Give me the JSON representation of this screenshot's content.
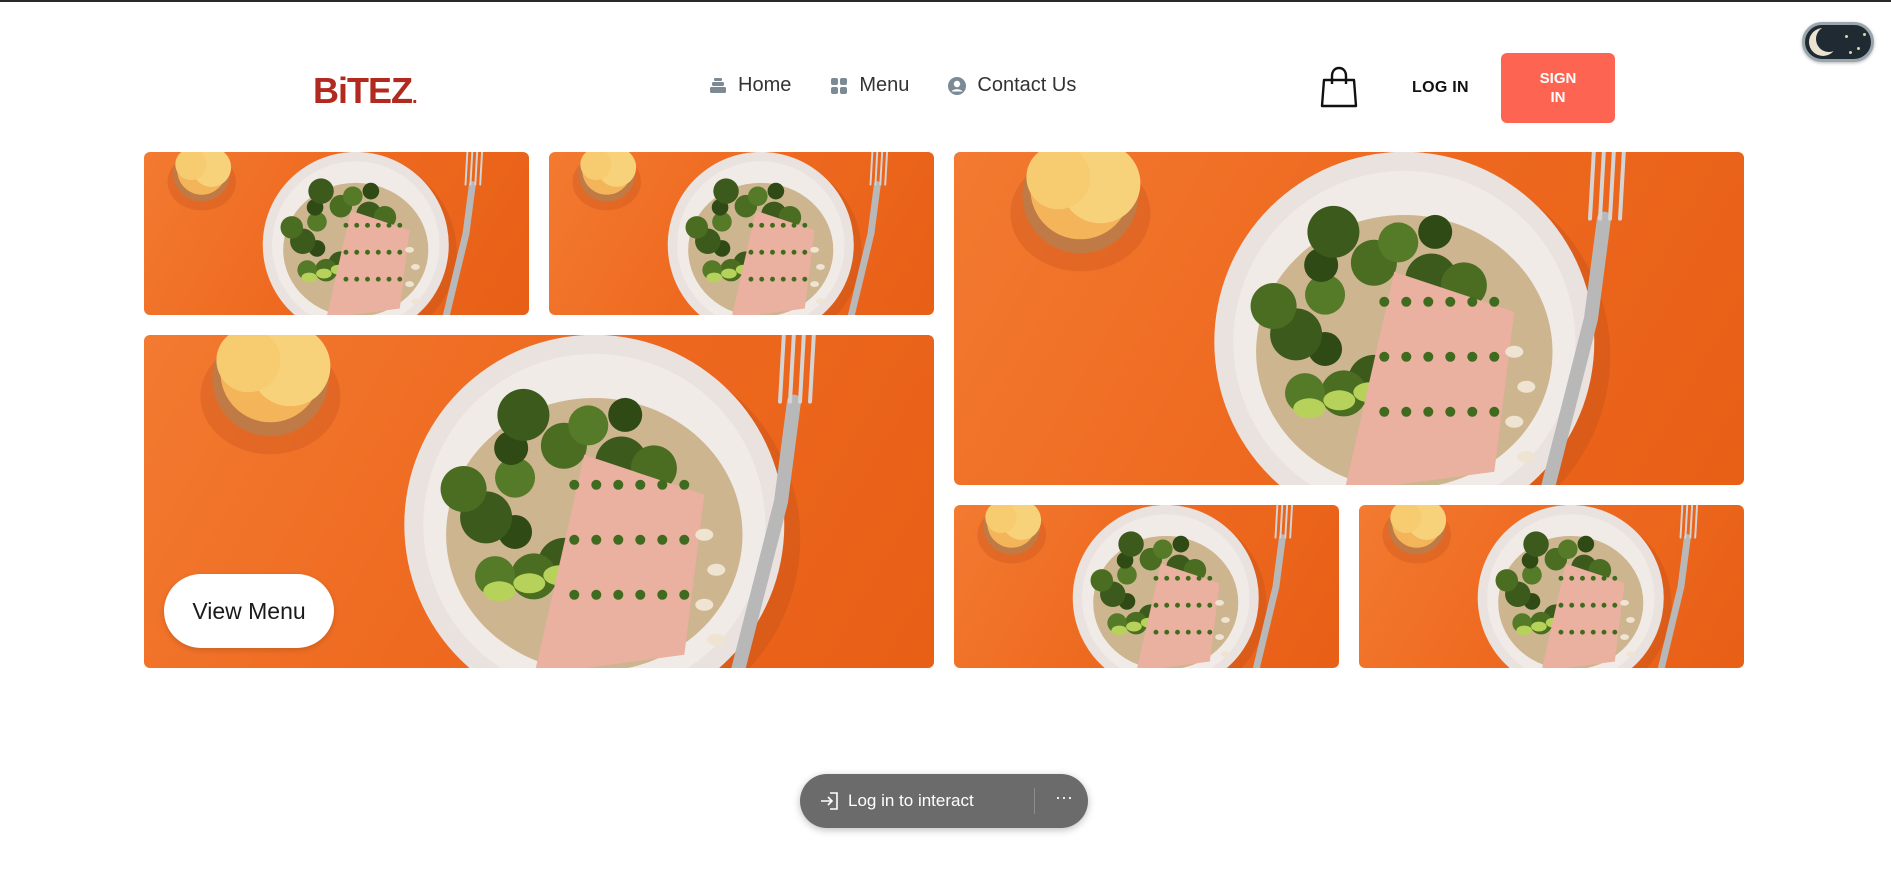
{
  "brand": {
    "logo_text": "BiTEZ",
    "logo_dot": ".",
    "accent_color": "#fd6552",
    "logo_color": "#b22a1f"
  },
  "nav": {
    "items": [
      {
        "label": "Home",
        "icon": "home-stack-icon"
      },
      {
        "label": "Menu",
        "icon": "grid-icon"
      },
      {
        "label": "Contact Us",
        "icon": "user-circle-icon"
      }
    ]
  },
  "header_actions": {
    "cart_icon": "shopping-bag-icon",
    "login_label": "LOG IN",
    "signin_label": "SIGN IN"
  },
  "theme_toggle": {
    "state": "dark",
    "icon": "moon-icon"
  },
  "hero": {
    "tile_image": "salmon-plate-on-orange",
    "cta_label": "View Menu"
  },
  "interact_bar": {
    "label": "Log in to interact",
    "login_icon": "login-arrow-icon",
    "more_icon": "more-dots-icon",
    "more_label": "···"
  }
}
